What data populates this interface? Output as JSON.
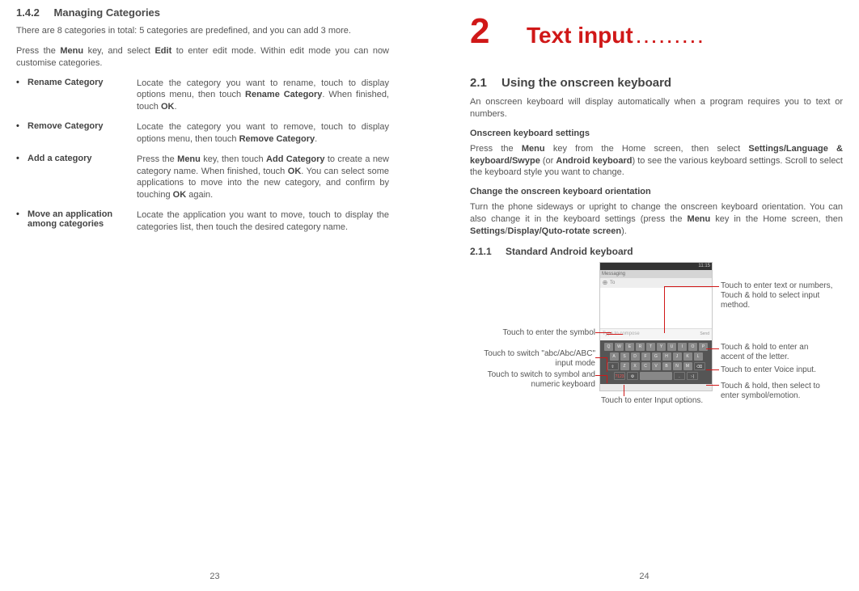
{
  "left": {
    "heading_num": "1.4.2",
    "heading_title": "Managing Categories",
    "intro": "There are 8 categories in total: 5 categories are predefined, and you can add 3 more.",
    "press_menu_pre": "Press the ",
    "press_menu_bold": "Menu",
    "press_menu_mid": " key, and select ",
    "press_menu_bold2": "Edit",
    "press_menu_post": " to enter edit mode. Within edit mode you can now customise categories.",
    "items": [
      {
        "label": "Rename Category",
        "desc_parts": [
          "Locate the category you want to rename, touch to display options menu, then touch ",
          "Rename Category",
          ". When finished, touch ",
          "OK",
          "."
        ]
      },
      {
        "label": "Remove Category",
        "desc_parts": [
          "Locate the category you want to remove, touch to display options menu, then touch ",
          "Remove Category",
          "."
        ]
      },
      {
        "label": "Add a category",
        "desc_parts": [
          "Press the ",
          "Menu",
          " key, then touch ",
          "Add Category",
          " to create a new category name. When finished, touch ",
          "OK",
          ". You can select some applications to move into the new category, and confirm by touching ",
          "OK",
          " again."
        ]
      },
      {
        "label": "Move an application among categories",
        "desc_parts": [
          "Locate the application you want to move, touch  to display the categories list, then touch the desired category name."
        ]
      }
    ],
    "page_num": "23"
  },
  "right": {
    "chapter_num": "2",
    "chapter_title": "Text input",
    "sec21_num": "2.1",
    "sec21_title": "Using the onscreen keyboard",
    "sec21_intro": "An onscreen keyboard will display automatically when a program requires you to text or numbers.",
    "kb_settings_head": "Onscreen keyboard settings",
    "kb_settings_pre": "Press the ",
    "kb_settings_b1": "Menu",
    "kb_settings_mid1": " key from the Home screen, then select ",
    "kb_settings_b2": "Settings/Language & keyboard/Swype",
    "kb_settings_mid2": " (or ",
    "kb_settings_b3": "Android keyboard",
    "kb_settings_post": ") to see the various keyboard settings. Scroll to select the keyboard style you want to change.",
    "orient_head": "Change the onscreen keyboard orientation",
    "orient_pre": "Turn the phone sideways or upright to change the onscreen keyboard orientation. You can also change it in the keyboard settings (press the ",
    "orient_b1": "Menu",
    "orient_mid1": " key in the Home screen, then ",
    "orient_b2": "Settings",
    "orient_slash": "/",
    "orient_b3": "Display/Quto-rotate screen",
    "orient_post": ").",
    "sec211_num": "2.1.1",
    "sec211_title": "Standard Android keyboard",
    "callouts": {
      "c_symbol": "Touch to enter the symbol",
      "c_abc": "Touch to switch \"abc/Abc/ABC\" input mode",
      "c_numeric": "Touch to switch to symbol and numeric keyboard",
      "c_input_options": "Touch to enter Input options.",
      "c_text_numbers": "Touch to enter text or numbers, Touch & hold to select input method.",
      "c_accent": "Touch & hold to enter an accent of the letter.",
      "c_voice": "Touch to enter Voice input.",
      "c_emotion": "Touch & hold, then select to enter symbol/emotion."
    },
    "kb_ui": {
      "time": "11:15",
      "title": "Messaging",
      "to": "To",
      "compose": "Type to compose",
      "send": "Send"
    },
    "page_num": "24"
  }
}
